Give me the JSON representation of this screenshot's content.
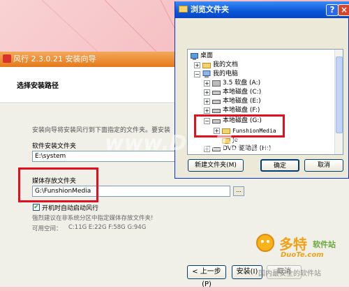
{
  "installer": {
    "title": "风行 2.3.0.21  安装向导",
    "header": "选择安装路径",
    "intro": "安装向导将安装风行到下面指定的文件夹。要安装",
    "software_folder_label": "软件安装文件夹",
    "software_folder_value": "E:\\system",
    "media_folder_label": "媒体存放文件夹",
    "media_folder_value": "G:\\FunshionMedia",
    "browse_label": "...",
    "autostart_label": "开机时自动启动风行",
    "autostart_checked": true,
    "advice": "强烈建议在非系统分区中指定媒体存放文件夹!",
    "space_label": "可用空间：",
    "space_values": "C:11G E:22G F:58G G:94G",
    "back_button": "< 上一步(P)",
    "install_button": "安装(I)",
    "cancel_button": "取消"
  },
  "dialog": {
    "title": "浏览文件夹",
    "help": "?",
    "close": "×",
    "tree": {
      "desktop": "桌面",
      "my_documents": "我的文档",
      "my_computer": "我的电脑",
      "floppy": "3.5 软盘 (A:)",
      "disk_c": "本地磁盘 (C:)",
      "disk_e": "本地磁盘 (E:)",
      "disk_f": "本地磁盘 (F:)",
      "disk_g": "本地磁盘 (G:)",
      "funshion": "FunshionMedia",
      "partial_folder": "Jё",
      "dvd": "DVD 驱动器 (H:)"
    },
    "new_folder_button": "新建文件夹(M)",
    "ok_button": "确定",
    "cancel_button": "取消"
  },
  "watermarks": {
    "duote_center": "www.DuoTe.com",
    "brand_cn": "多特",
    "brand_sub": "软件站",
    "brand_en": "DuoTe.com",
    "bottom_text": "国内最安全的软件站"
  },
  "colors": {
    "highlight_red": "#e01020",
    "xp_title_blue": "#0a56d8",
    "installer_title_orange": "#e47a1c"
  }
}
